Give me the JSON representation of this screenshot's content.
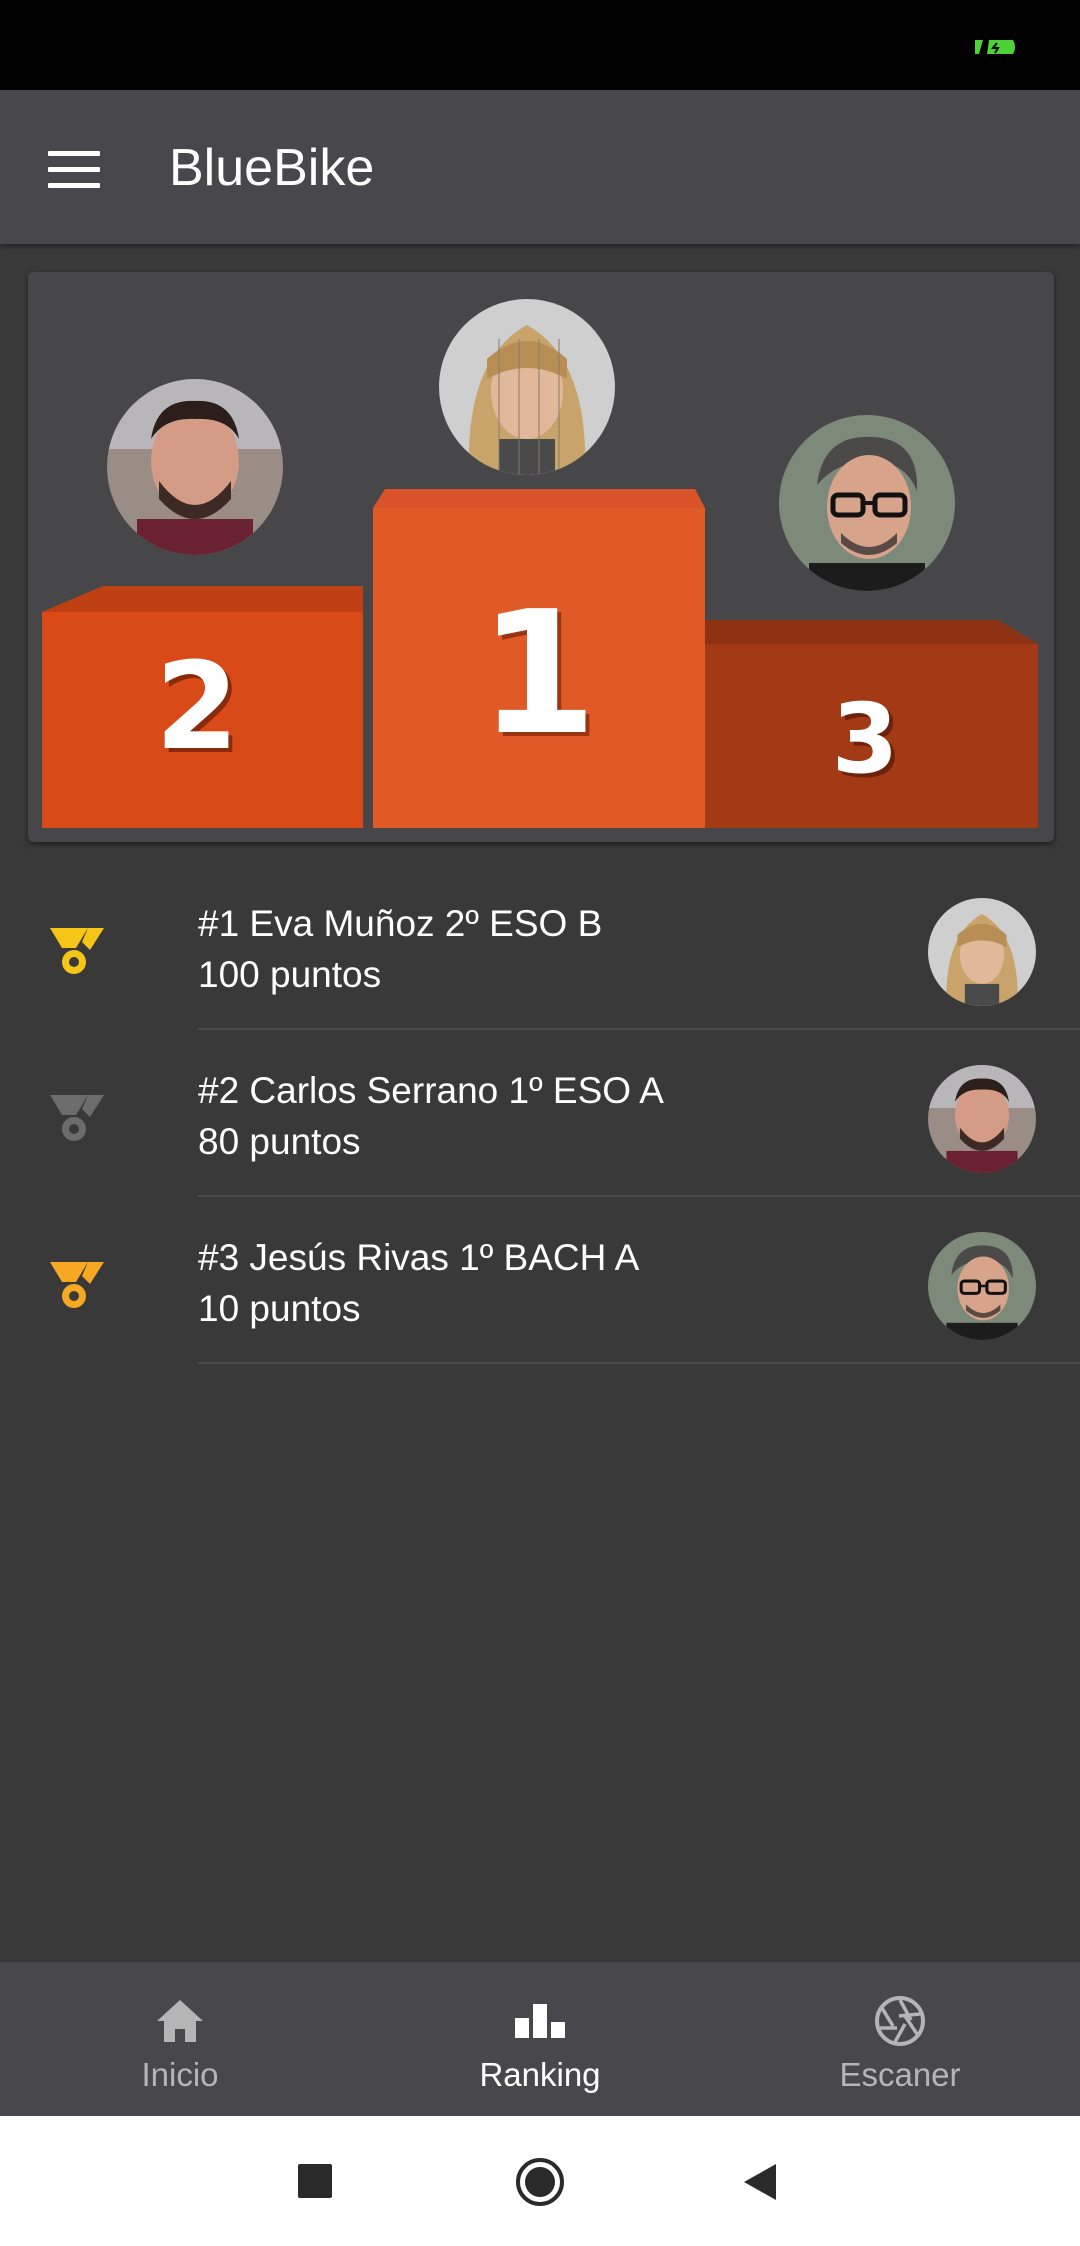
{
  "app": {
    "title": "BlueBike"
  },
  "podium": {
    "places": [
      {
        "number": "1",
        "avatar_icon": "avatar-eva-icon"
      },
      {
        "number": "2",
        "avatar_icon": "avatar-carlos-icon"
      },
      {
        "number": "3",
        "avatar_icon": "avatar-jesus-icon"
      }
    ],
    "colors": {
      "first": "#e05a28",
      "second": "#d84a17",
      "third": "#a33a16"
    }
  },
  "ranking": [
    {
      "title": "#1 Eva Muñoz 2º ESO B",
      "points": "100 puntos",
      "medal_color": "#f5c518",
      "medal_icon": "medal-gold-icon"
    },
    {
      "title": "#2 Carlos Serrano 1º ESO A",
      "points": "80 puntos",
      "medal_color": "#6c6c6c",
      "medal_icon": "medal-silver-icon"
    },
    {
      "title": "#3 Jesús Rivas 1º BACH A",
      "points": "10 puntos",
      "medal_color": "#f7a823",
      "medal_icon": "medal-bronze-icon"
    }
  ],
  "bottom_nav": {
    "items": [
      {
        "label": "Inicio",
        "icon": "home-icon",
        "active": false
      },
      {
        "label": "Ranking",
        "icon": "bar-chart-icon",
        "active": true
      },
      {
        "label": "Escaner",
        "icon": "shutter-icon",
        "active": false
      }
    ],
    "active_color": "#ffffff",
    "inactive_color": "#b5b5b5"
  }
}
